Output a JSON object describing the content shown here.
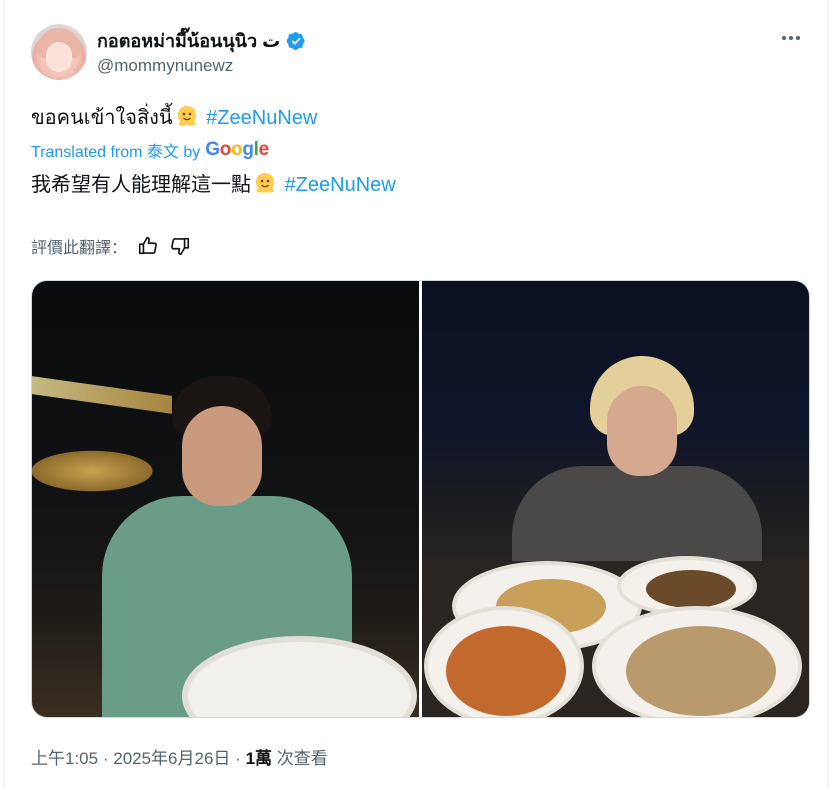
{
  "author": {
    "display_name": "กอตอหม่ามี๊น้อนนุนิว ت",
    "handle": "@mommynunewz",
    "verified": true
  },
  "tweet": {
    "original_text": "ขอคนเข้าใจสิ่งนี้",
    "original_hashtag": "#ZeeNuNew",
    "translated_label": "Translated from 泰文 by",
    "translation_provider": "Google",
    "translated_text": "我希望有人能理解這一點",
    "translated_hashtag": "#ZeeNuNew",
    "rate_translation_label": "評價此翻譯："
  },
  "meta": {
    "time": "上午1:05",
    "separator": "·",
    "date": "2025年6月26日",
    "views_count": "1萬",
    "views_label": "次查看"
  },
  "icons": {
    "more": "more-icon",
    "verified": "verified-badge-icon",
    "emoji": "melting-face-emoji-icon",
    "thumbs_up": "thumbs-up-icon",
    "thumbs_down": "thumbs-down-icon"
  },
  "colors": {
    "accent": "#1d9bf0",
    "secondary_text": "#536471",
    "primary_text": "#0f1419"
  }
}
